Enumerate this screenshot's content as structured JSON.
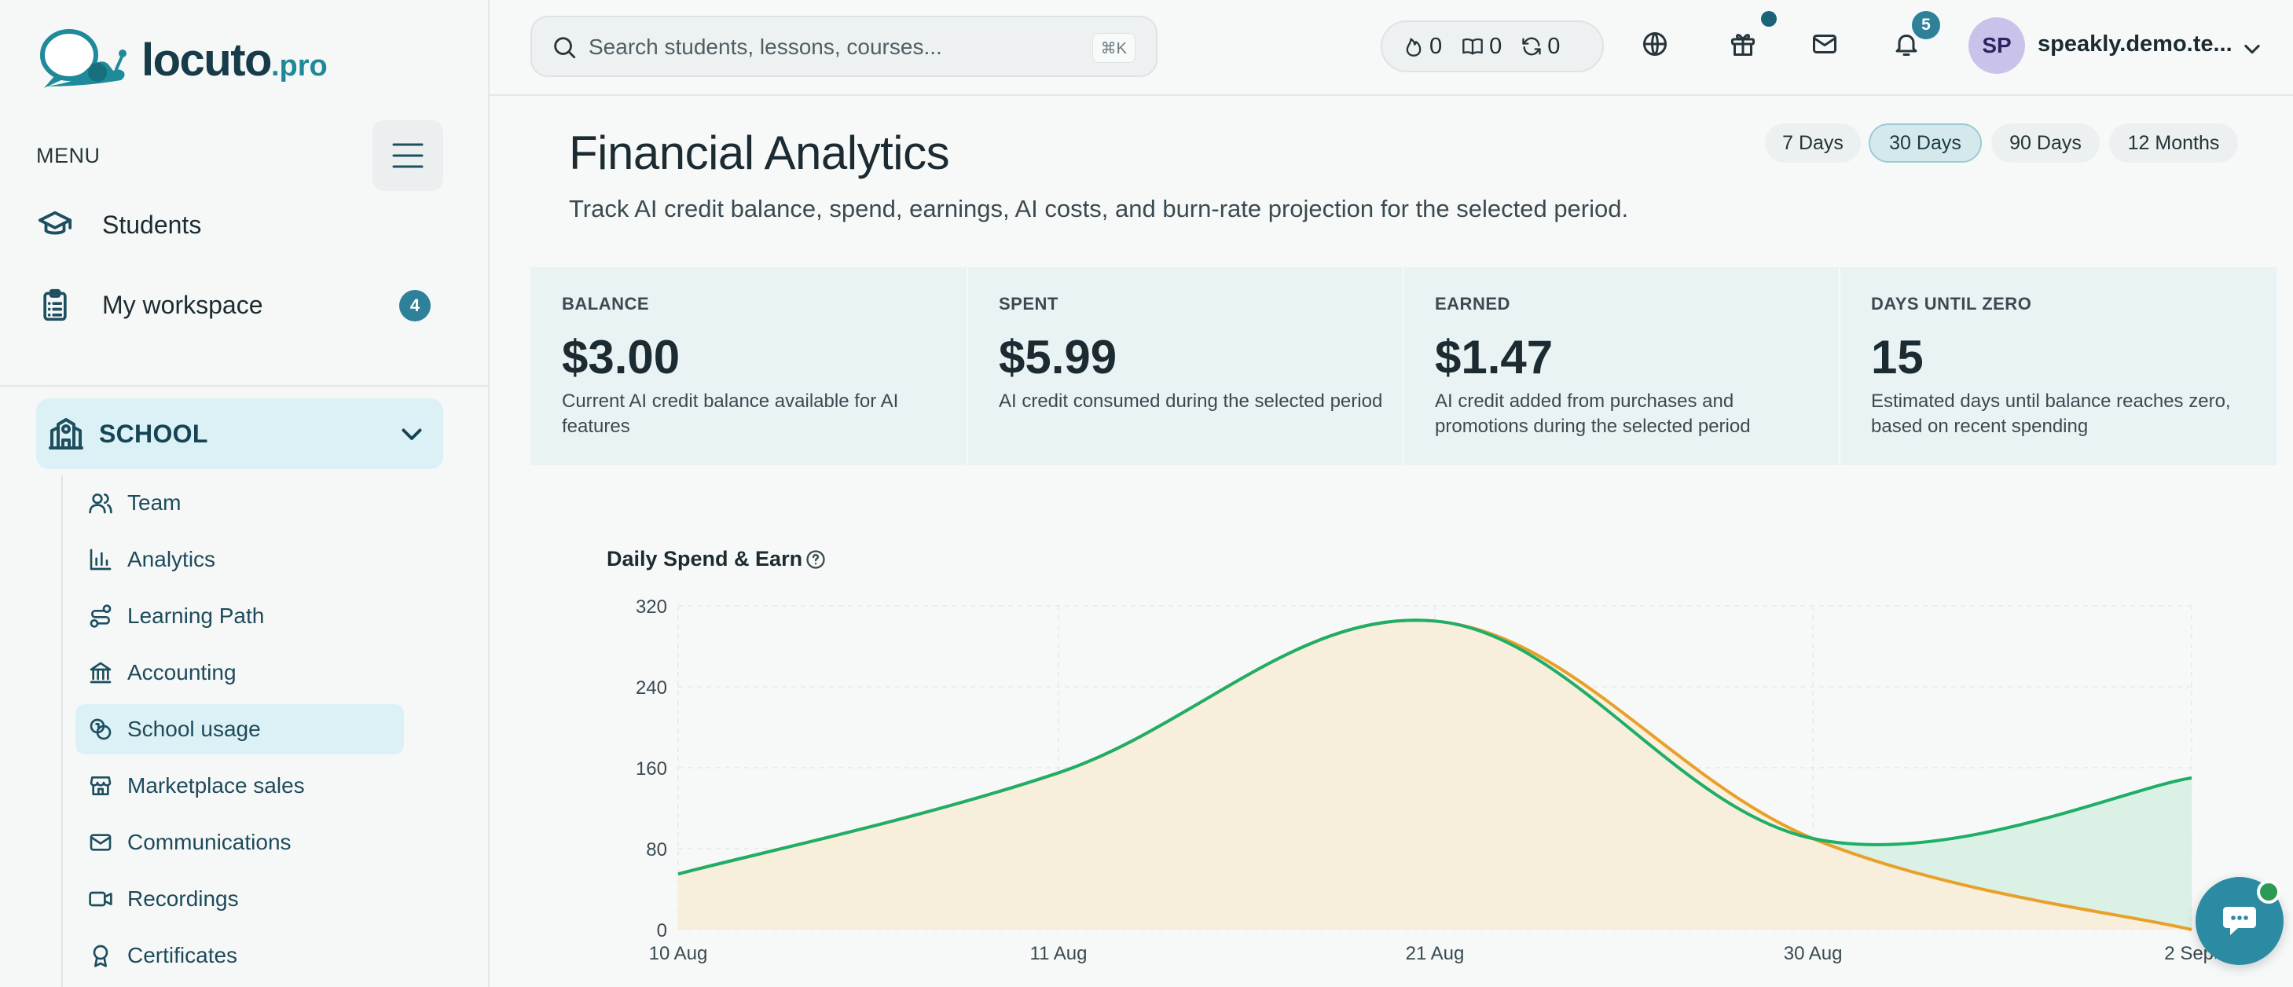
{
  "brand": {
    "name": "locuto",
    "tld": ".pro"
  },
  "sidebar": {
    "menu_label": "MENU",
    "top_items": [
      {
        "label": "Students",
        "icon": "graduation-cap-icon"
      },
      {
        "label": "My workspace",
        "icon": "clipboard-icon",
        "badge": "4"
      }
    ],
    "section": {
      "label": "SCHOOL",
      "icon": "school-building-icon",
      "expanded": true
    },
    "sub_items": [
      {
        "label": "Team",
        "icon": "users-icon",
        "active": false
      },
      {
        "label": "Analytics",
        "icon": "bar-chart-icon",
        "active": false
      },
      {
        "label": "Learning Path",
        "icon": "route-icon",
        "active": false
      },
      {
        "label": "Accounting",
        "icon": "bank-icon",
        "active": false
      },
      {
        "label": "School usage",
        "icon": "coins-icon",
        "active": true
      },
      {
        "label": "Marketplace sales",
        "icon": "store-icon",
        "active": false
      },
      {
        "label": "Communications",
        "icon": "mail-icon",
        "active": false
      },
      {
        "label": "Recordings",
        "icon": "video-icon",
        "active": false
      },
      {
        "label": "Certificates",
        "icon": "award-icon",
        "active": false
      }
    ]
  },
  "topbar": {
    "search_placeholder": "Search students, lessons, courses...",
    "search_shortcut": "⌘K",
    "stats": [
      {
        "icon": "flame-icon",
        "value": "0"
      },
      {
        "icon": "book-open-icon",
        "value": "0"
      },
      {
        "icon": "refresh-icon",
        "value": "0"
      }
    ],
    "notifications_count": "5",
    "user": {
      "initials": "SP",
      "name": "speakly.demo.te..."
    }
  },
  "page": {
    "title": "Financial Analytics",
    "description": "Track AI credit balance, spend, earnings, AI costs, and burn-rate projection for the selected period.",
    "periods": [
      {
        "label": "7 Days",
        "active": false
      },
      {
        "label": "30 Days",
        "active": true
      },
      {
        "label": "90 Days",
        "active": false
      },
      {
        "label": "12 Months",
        "active": false
      }
    ]
  },
  "kpis": [
    {
      "label": "BALANCE",
      "value": "$3.00",
      "description": "Current AI credit balance available for AI features"
    },
    {
      "label": "SPENT",
      "value": "$5.99",
      "description": "AI credit consumed during the selected period"
    },
    {
      "label": "EARNED",
      "value": "$1.47",
      "description": "AI credit added from purchases and promotions during the selected period"
    },
    {
      "label": "DAYS UNTIL ZERO",
      "value": "15",
      "description": "Estimated days until balance reaches zero, based on recent spending"
    }
  ],
  "colors": {
    "accent": "#2e8199",
    "spend_line": "#e8a02a",
    "spend_fill": "#fbedd8",
    "earn_line": "#1fae68",
    "earn_fill": "#d8efe3"
  },
  "chart_data": {
    "type": "area",
    "title": "Daily Spend & Earn",
    "xlabel": "",
    "ylabel": "",
    "x": [
      "10 Aug",
      "11 Aug",
      "21 Aug",
      "30 Aug",
      "2 Sept"
    ],
    "y_ticks": [
      0,
      80,
      160,
      240,
      320
    ],
    "ylim": [
      0,
      320
    ],
    "grid": true,
    "series": [
      {
        "values": [
          55,
          155,
          305,
          90,
          0
        ]
      },
      {
        "values": [
          55,
          155,
          305,
          90,
          150
        ]
      }
    ]
  }
}
